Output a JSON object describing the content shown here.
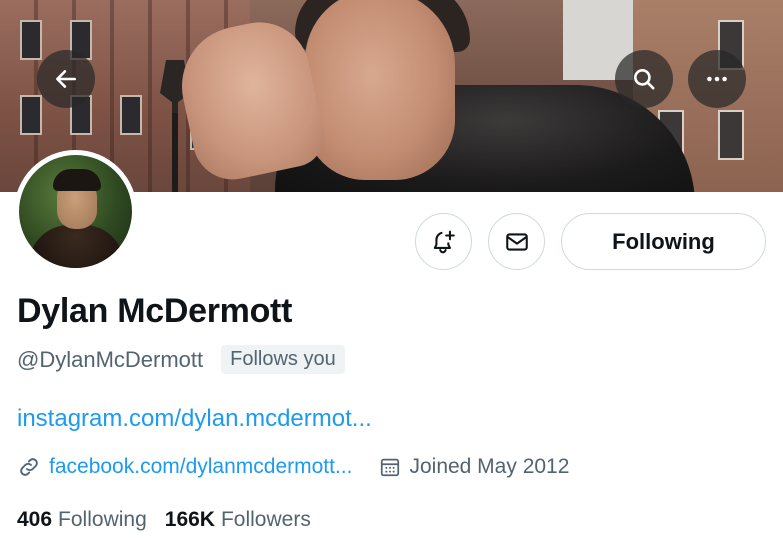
{
  "profile": {
    "display_name": "Dylan McDermott",
    "handle": "@DylanMcDermott",
    "follows_you": "Follows you",
    "bio_link": "instagram.com/dylan.mcdermot...",
    "website": "facebook.com/dylanmcdermott...",
    "joined": "Joined May 2012"
  },
  "stats": {
    "following_count": "406",
    "following_label": "Following",
    "followers_count": "166K",
    "followers_label": "Followers"
  },
  "actions": {
    "following_button": "Following"
  },
  "icons": {
    "back": "arrow-left-icon",
    "search": "search-icon",
    "more": "more-horizontal-icon",
    "notify": "bell-plus-icon",
    "message": "envelope-icon",
    "link": "link-icon",
    "calendar": "calendar-icon"
  },
  "colors": {
    "link": "#1d9bf0",
    "secondary_text": "#536471",
    "primary_text": "#0f1419",
    "border": "#cfd9de"
  }
}
